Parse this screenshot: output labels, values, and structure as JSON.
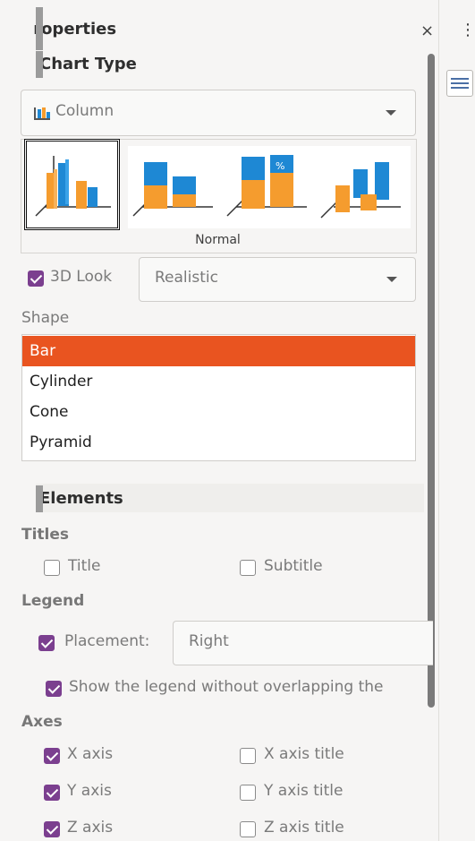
{
  "panel": {
    "title": "Properties",
    "menu_glyph": "⋮",
    "close_glyph": "×"
  },
  "chart_type": {
    "section_title": "Chart Type",
    "type_value": "Column",
    "variant_label": "Normal",
    "look_3d_label": "3D Look",
    "look_3d_checked": true,
    "look_3d_value": "Realistic",
    "shape_label": "Shape",
    "shapes": [
      "Bar",
      "Cylinder",
      "Cone",
      "Pyramid"
    ],
    "shape_selected": "Bar"
  },
  "elements": {
    "section_title": "Elements",
    "titles_label": "Titles",
    "title_cb": "Title",
    "title_checked": false,
    "subtitle_cb": "Subtitle",
    "subtitle_checked": false,
    "legend_label": "Legend",
    "placement_cb": "Placement:",
    "placement_checked": true,
    "placement_value": "Right",
    "overlap_cb": "Show the legend without overlapping the",
    "overlap_checked": true,
    "axes_label": "Axes",
    "x_axis": "X axis",
    "x_axis_checked": true,
    "x_axis_title": "X axis title",
    "x_axis_title_checked": false,
    "y_axis": "Y axis",
    "y_axis_checked": true,
    "y_axis_title": "Y axis title",
    "y_axis_title_checked": false,
    "z_axis": "Z axis",
    "z_axis_checked": true,
    "z_axis_title": "Z axis title",
    "z_axis_title_checked": false
  },
  "colors": {
    "accent": "#7b3f8f",
    "selection": "#e95420",
    "bar_blue": "#1e88d4",
    "bar_orange": "#f59c2e"
  }
}
